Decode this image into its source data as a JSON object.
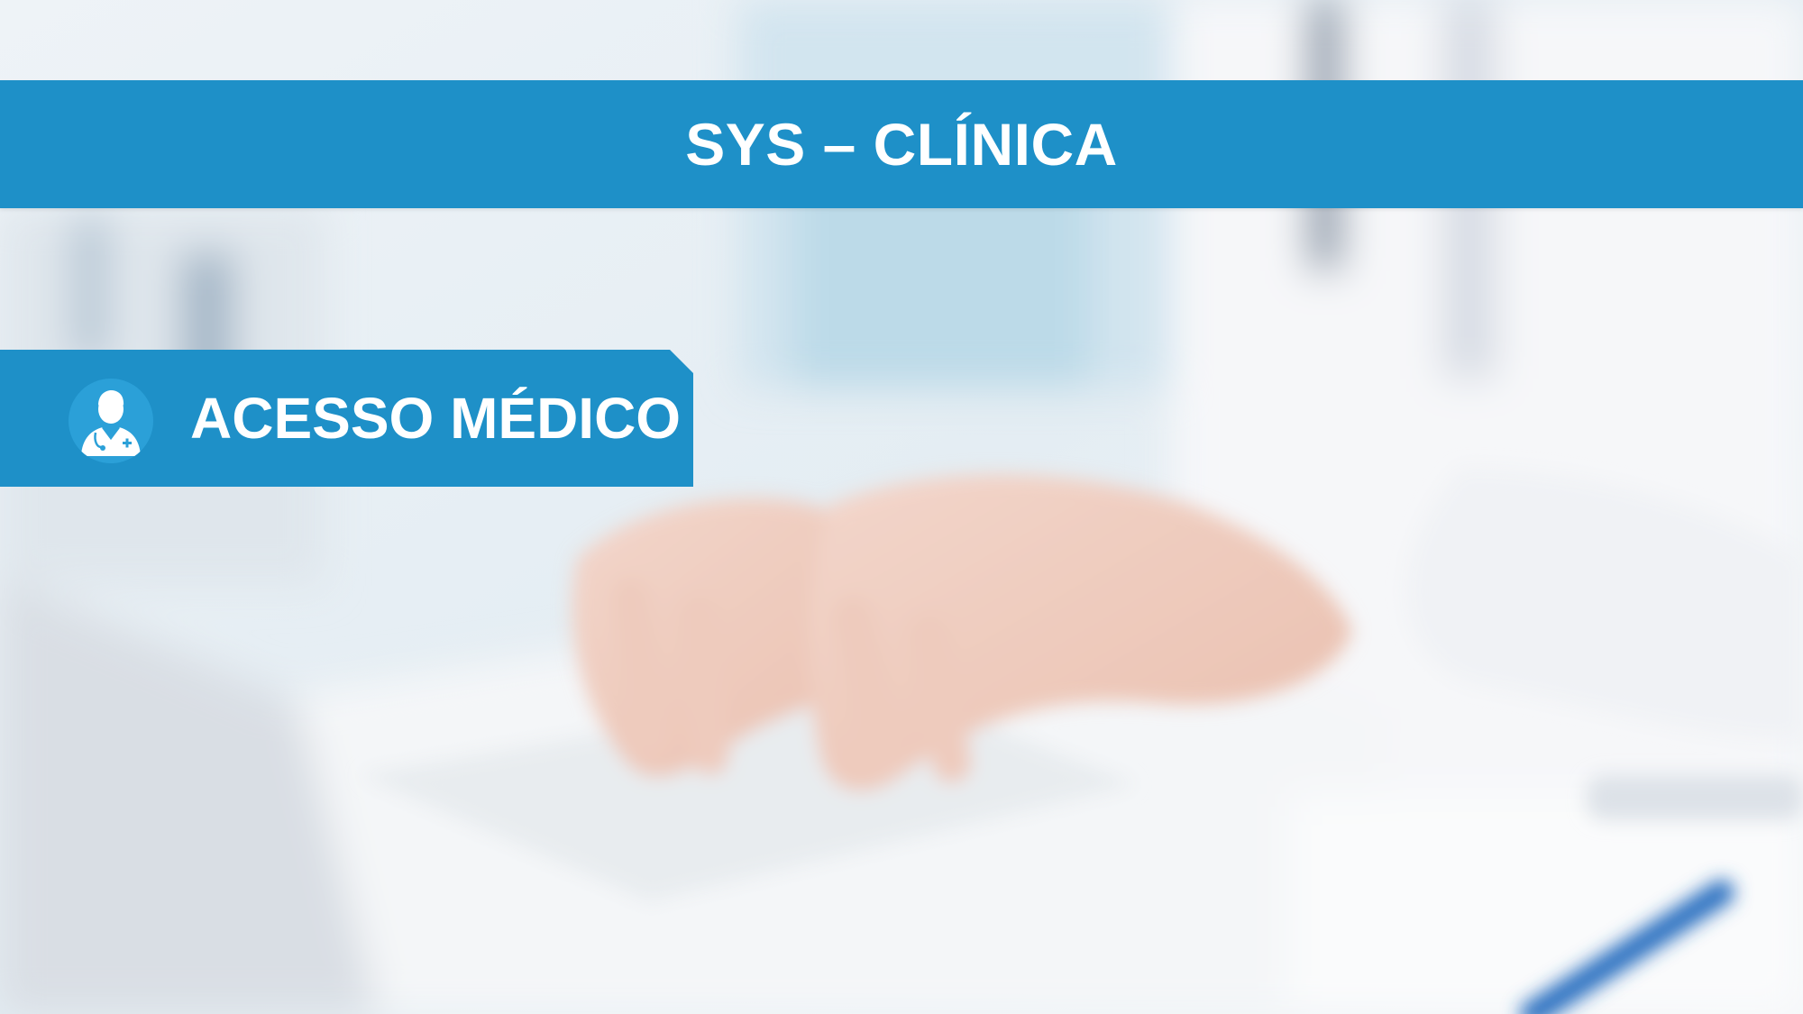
{
  "header": {
    "title": "SYS – CLÍNICA"
  },
  "access": {
    "label": "ACESSO MÉDICO",
    "icon": "doctor-avatar-icon"
  },
  "colors": {
    "accent": "#1e90c8",
    "text": "#ffffff"
  }
}
